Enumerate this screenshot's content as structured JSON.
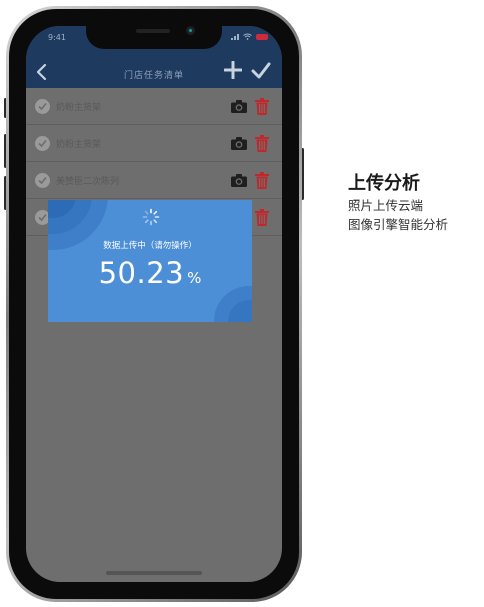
{
  "status_bar": {
    "time": "9:41"
  },
  "header": {
    "title": "门店任务清单",
    "back_icon": "chevron-left-icon",
    "add_icon": "plus-icon",
    "confirm_icon": "check-icon"
  },
  "tasks": [
    {
      "label": "奶粉主货架",
      "checked": true
    },
    {
      "label": "奶粉主货架",
      "checked": true
    },
    {
      "label": "美赞臣二次陈列",
      "checked": true
    },
    {
      "label": "",
      "checked": true
    }
  ],
  "upload_dialog": {
    "message": "数据上传中（请勿操作）",
    "progress_value": "50.23",
    "progress_unit": "%",
    "progress_percent": 50.23
  },
  "caption": {
    "title": "上传分析",
    "lines": [
      "照片上传云端",
      "图像引擎智能分析"
    ]
  },
  "colors": {
    "header_bg": "#1e3a5f",
    "modal_bg": "#4d8fd6",
    "trash_red": "#c0282b",
    "overlay": "#6e6e6e"
  }
}
